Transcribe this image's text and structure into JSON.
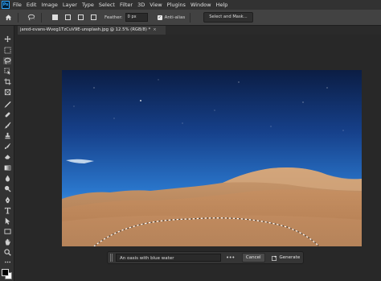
{
  "app": {
    "logo": "Ps"
  },
  "menubar": {
    "items": [
      "File",
      "Edit",
      "Image",
      "Layer",
      "Type",
      "Select",
      "Filter",
      "3D",
      "View",
      "Plugins",
      "Window",
      "Help"
    ]
  },
  "options": {
    "feather_label": "Feather:",
    "feather_value": "0 px",
    "antialias_label": "Anti-alias",
    "antialias_checked": true,
    "select_mask_label": "Select and Mask..."
  },
  "document": {
    "tab_title": "jared-evans-Wveg1TzCuV9E-unsplash.jpg @ 12.5% (RGB/8) *",
    "tab_close": "×"
  },
  "toolbar": {
    "tools": [
      "move-icon",
      "marquee-icon",
      "lasso-icon",
      "object-select-icon",
      "crop-icon",
      "frame-icon",
      "eyedropper-icon",
      "healing-brush-icon",
      "brush-icon",
      "clone-stamp-icon",
      "history-brush-icon",
      "eraser-icon",
      "gradient-icon",
      "blur-icon",
      "dodge-icon",
      "pen-icon",
      "type-icon",
      "path-select-icon",
      "rectangle-icon",
      "hand-icon",
      "zoom-icon",
      "more-tools-icon"
    ],
    "active_tool": "lasso-icon",
    "foreground_color": "#000000",
    "background_color": "#ffffff"
  },
  "contextual_taskbar": {
    "prompt_value": "An oasis with blue water",
    "more_label": "•••",
    "cancel_label": "Cancel",
    "generate_label": "Generate"
  }
}
